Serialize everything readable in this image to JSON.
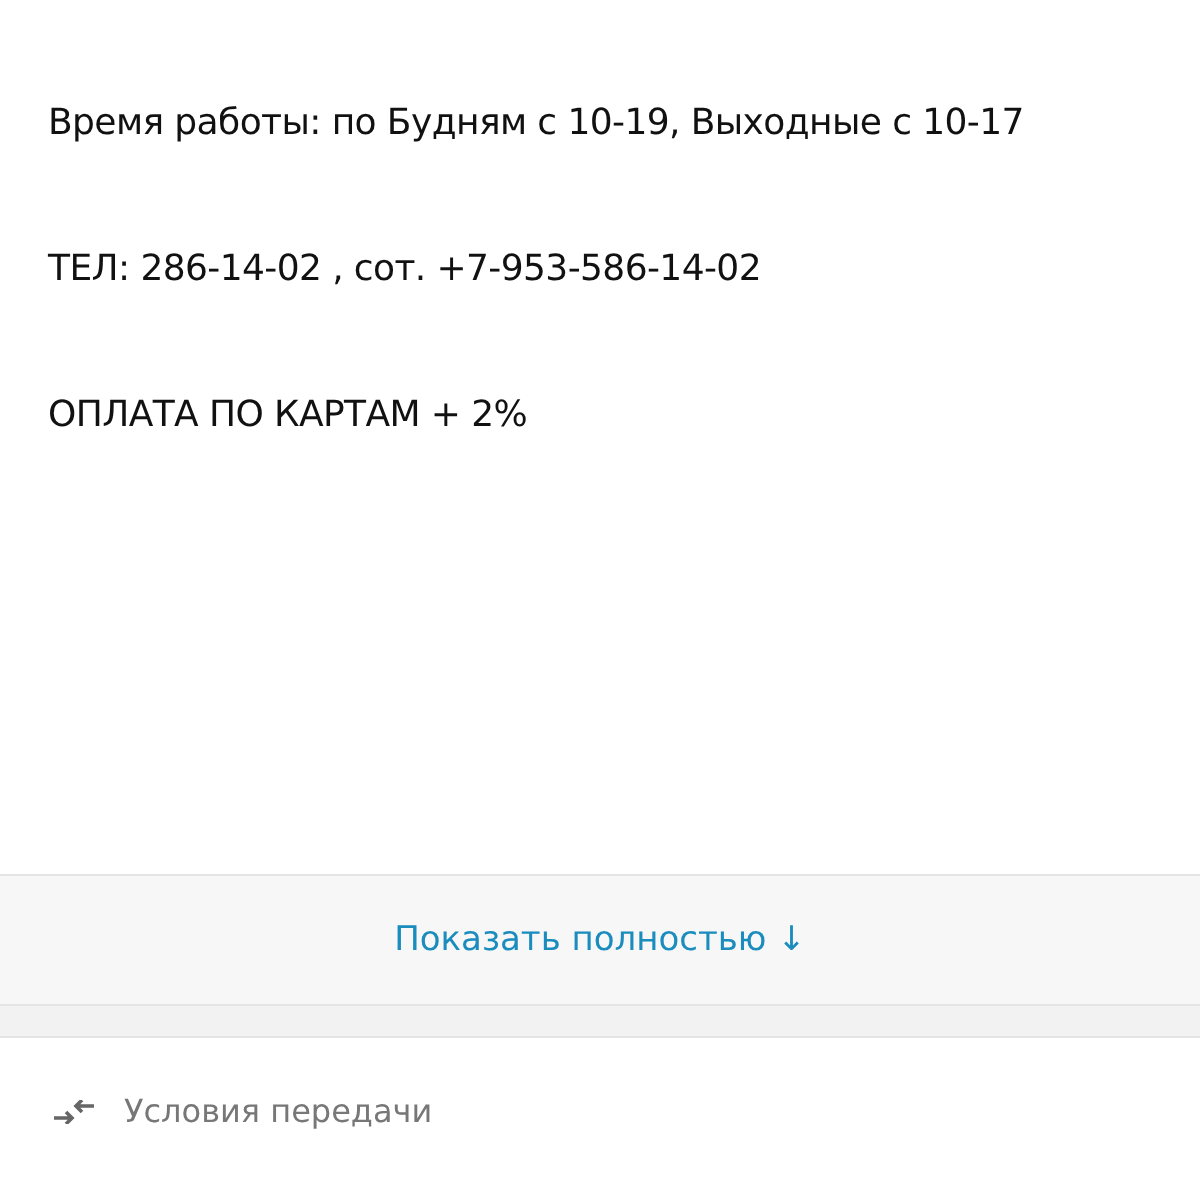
{
  "description": {
    "lines": [
      "Время работы: по Будням с 10-19, Выходные с 10-17",
      "ТЕЛ: 286-14-02 , сот. +7-953-586-14-02",
      "ОПЛАТА ПО КАРТАМ + 2%"
    ]
  },
  "show_more": {
    "label": "Показать полностью ↓"
  },
  "delivery": {
    "label": "Условия передачи"
  }
}
